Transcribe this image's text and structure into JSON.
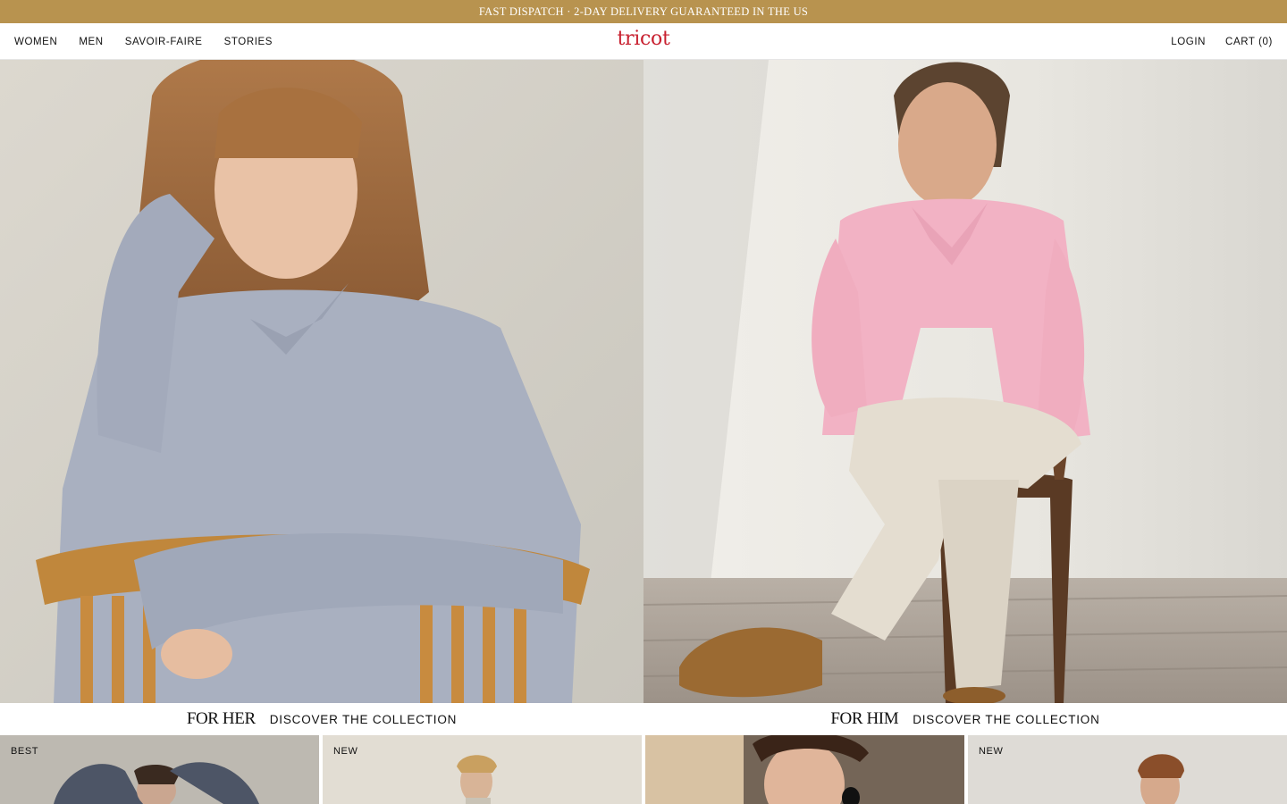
{
  "announcement": "FAST DISPATCH · 2-DAY DELIVERY GUARANTEED IN THE US",
  "header": {
    "logo": "tricot",
    "nav_left": [
      "WOMEN",
      "MEN",
      "SAVOIR-FAIRE",
      "STORIES"
    ],
    "login": "LOGIN",
    "cart": "CART (0)"
  },
  "hero": [
    {
      "title": "FOR HER",
      "cta": "DISCOVER THE COLLECTION"
    },
    {
      "title": "FOR HIM",
      "cta": "DISCOVER THE COLLECTION"
    }
  ],
  "products": [
    {
      "badge": "BEST"
    },
    {
      "badge": "NEW"
    },
    {
      "badge": ""
    },
    {
      "badge": "NEW"
    }
  ],
  "colors": {
    "announcement_bg": "#b8934f",
    "logo": "#c8202f"
  }
}
